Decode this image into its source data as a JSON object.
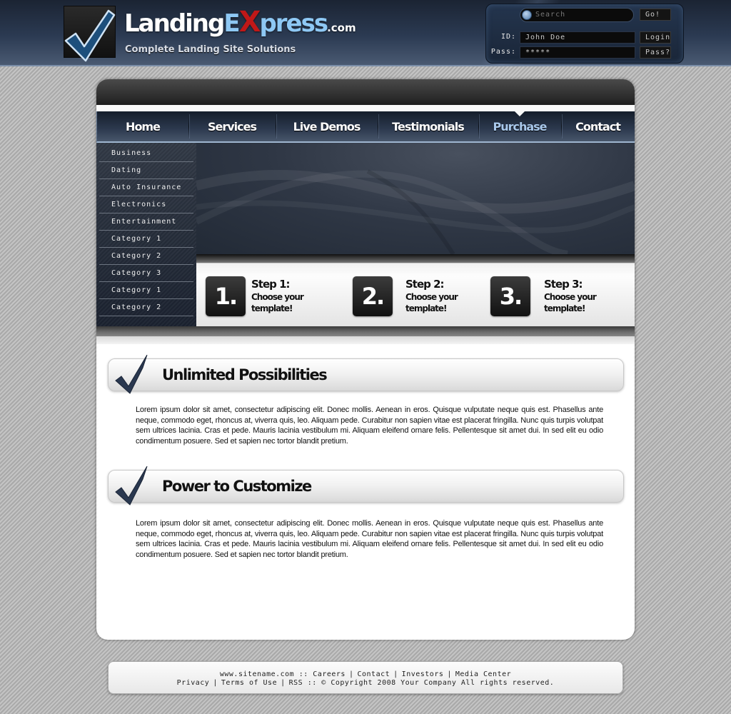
{
  "header": {
    "logo": {
      "name_part1": "Landing",
      "name_part2": "E",
      "name_x": "X",
      "name_part3": "press",
      "domain": ".com",
      "tagline": "Complete Landing Site Solutions"
    },
    "search": {
      "placeholder": "Search",
      "go_label": "Go!"
    },
    "login": {
      "id_label": "ID:",
      "id_value": "John Doe",
      "pass_label": "Pass:",
      "pass_value": "*****",
      "login_label": "Login",
      "forgot_label": "Pass?"
    }
  },
  "nav": {
    "items": [
      {
        "label": "Home",
        "active": false
      },
      {
        "label": "Services",
        "active": false
      },
      {
        "label": "Live Demos",
        "active": false
      },
      {
        "label": "Testimonials",
        "active": false
      },
      {
        "label": "Purchase",
        "active": true
      },
      {
        "label": "Contact",
        "active": false
      }
    ]
  },
  "sidebar": {
    "items": [
      {
        "label": "Business"
      },
      {
        "label": "Dating"
      },
      {
        "label": "Auto Insurance"
      },
      {
        "label": "Electronics"
      },
      {
        "label": "Entertainment"
      },
      {
        "label": "Category 1"
      },
      {
        "label": "Category 2"
      },
      {
        "label": "Category 3"
      },
      {
        "label": "Category 1"
      },
      {
        "label": "Category 2"
      }
    ]
  },
  "steps": [
    {
      "number": "1.",
      "title": "Step 1:",
      "description": "Choose your template!"
    },
    {
      "number": "2.",
      "title": "Step 2:",
      "description": "Choose your template!"
    },
    {
      "number": "3.",
      "title": "Step 3:",
      "description": "Choose your template!"
    }
  ],
  "sections": [
    {
      "title": "Unlimited Possibilities",
      "body": "Lorem ipsum dolor sit amet, consectetur adipiscing elit. Donec mollis. Aenean in eros. Quisque vulputate neque quis est. Phasellus ante neque, commodo eget, rhoncus at, viverra quis, leo. Aliquam pede. Curabitur non sapien vitae est placerat fringilla. Nunc quis turpis volutpat sem ultrices lacinia. Cras et pede. Mauris lacinia vestibulum mi. Aliquam eleifend ornare felis. Pellentesque sit amet dui. In sed elit eu odio condimentum posuere. Sed et sapien nec tortor blandit pretium."
    },
    {
      "title": "Power to Customize",
      "body": "Lorem ipsum dolor sit amet, consectetur adipiscing elit. Donec mollis. Aenean in eros. Quisque vulputate neque quis est. Phasellus ante neque, commodo eget, rhoncus at, viverra quis, leo. Aliquam pede. Curabitur non sapien vitae est placerat fringilla. Nunc quis turpis volutpat sem ultrices lacinia. Cras et pede. Mauris lacinia vestibulum mi. Aliquam eleifend ornare felis. Pellentesque sit amet dui. In sed elit eu odio condimentum posuere. Sed et sapien nec tortor blandit pretium."
    }
  ],
  "footer": {
    "site": "www.sitename.com",
    "sep_double": "::",
    "sep_pipe": "|",
    "line1_links": [
      "Careers",
      "Contact",
      "Investors",
      "Media Center"
    ],
    "line2_links": [
      "Privacy",
      "Terms of Use",
      "RSS"
    ],
    "copyright": "© Copyright 2008 Your Company  All rights reserved."
  },
  "colors": {
    "accent_blue": "#8ec8f4",
    "logo_x_red": "#c01818",
    "nav_active": "#a9c9ec",
    "header_dark": "#1b2433"
  }
}
